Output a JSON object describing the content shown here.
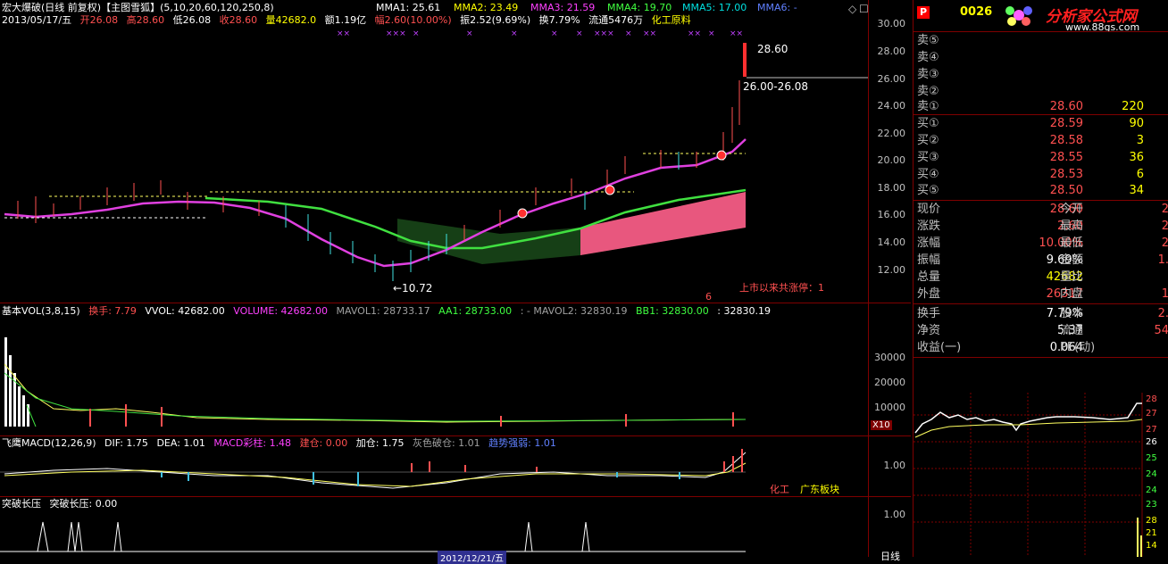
{
  "stock_header": {
    "title": "宏大爆破(日线 前复权)【主图雪狐】",
    "params": "(5,10,20,60,120,250,8)",
    "mma1": "MMA1: 25.61",
    "mma2": "MMA2: 23.49",
    "mma3": "MMA3: 21.59",
    "mma4": "MMA4: 19.70",
    "mma5": "MMA5: 17.00",
    "mma6": "MMA6: -"
  },
  "quote_line": {
    "date": "2013/05/17/五",
    "open": "开26.08",
    "high": "高28.60",
    "low": "低26.08",
    "close": "收28.60",
    "volume": "量42682.0",
    "amount": "额1.19亿",
    "change": "幅2.60(10.00%)",
    "amplitude": "振2.52(9.69%)",
    "turnover": "换7.79%",
    "float": "流通5476万",
    "industry": "化工原料"
  },
  "main_chart": {
    "annotations": {
      "high_price": "28.60",
      "range": "26.00-26.08",
      "low_price": "←10.72",
      "limit_up_text": "上市以来共涨停：1",
      "marker_six": "6"
    },
    "y_ticks": [
      "30.00",
      "28.00",
      "26.00",
      "24.00",
      "22.00",
      "20.00",
      "18.00",
      "16.00",
      "14.00",
      "12.00"
    ]
  },
  "vol_panel": {
    "title": "基本VOL(3,8,15)",
    "turnover": "换手: 7.79",
    "vvol": "VVOL: 42682.00",
    "volume": "VOLUME: 42682.00",
    "mavol1": "MAVOL1: 28733.17",
    "aa1": "AA1: 28733.00",
    "mavol2": ": - MAVOL2: 32830.19",
    "bb1": "BB1: 32830.00",
    "last": ": 32830.19",
    "y_ticks": [
      "30000",
      "20000",
      "10000"
    ],
    "unit": "X10"
  },
  "macd_panel": {
    "title": "飞鹰MACD(12,26,9)",
    "dif": "DIF: 1.75",
    "dea": "DEA: 1.01",
    "macd": "MACD彩柱: 1.48",
    "build": "建仓: 0.00",
    "add": "加仓: 1.75",
    "gray_break": "灰色破仓: 1.01",
    "trend": "趋势强弱: 1.01",
    "y_ticks": [
      "1.00"
    ],
    "sector_a": "化工",
    "sector_b": "广东板块"
  },
  "break_panel": {
    "title": "突破长压",
    "value": "突破长压: 0.00",
    "y_ticks": [
      "1.00"
    ],
    "bottom_date": "2012/12/21/五",
    "bottom_right": "日线"
  },
  "order_book": {
    "code": "0026",
    "logo_text": "分析家公式网",
    "logo_url": "www.88gs.com",
    "asks": [
      {
        "label": "卖⑤",
        "price": "",
        "vol": ""
      },
      {
        "label": "卖④",
        "price": "",
        "vol": ""
      },
      {
        "label": "卖③",
        "price": "",
        "vol": ""
      },
      {
        "label": "卖②",
        "price": "",
        "vol": ""
      },
      {
        "label": "卖①",
        "price": "28.60",
        "vol": "220"
      }
    ],
    "bids": [
      {
        "label": "买①",
        "price": "28.59",
        "vol": "90"
      },
      {
        "label": "买②",
        "price": "28.58",
        "vol": "3"
      },
      {
        "label": "买③",
        "price": "28.55",
        "vol": "36"
      },
      {
        "label": "买④",
        "price": "28.53",
        "vol": "6"
      },
      {
        "label": "买⑤",
        "price": "28.50",
        "vol": "34"
      }
    ],
    "stats": [
      {
        "label": "现价",
        "value": "28.60",
        "label2": "今开",
        "value2": "2"
      },
      {
        "label": "涨跌",
        "value": "2.60",
        "label2": "最高",
        "value2": "2"
      },
      {
        "label": "涨幅",
        "value": "10.00%",
        "label2": "最低",
        "value2": "2"
      },
      {
        "label": "振幅",
        "value": "9.69%",
        "label2": "金额",
        "value2": "1."
      },
      {
        "label": "总量",
        "value": "42682",
        "label2": "量比",
        "value2": ""
      },
      {
        "label": "外盘",
        "value": "26317",
        "label2": "内盘",
        "value2": "1"
      }
    ],
    "stats2": [
      {
        "label": "换手",
        "value": "7.79%",
        "label2": "股本",
        "value2": "2."
      },
      {
        "label": "净资",
        "value": "5.37",
        "label2": "流通",
        "value2": "54"
      },
      {
        "label": "收益(一)",
        "value": "0.064",
        "label2": "PE(动)",
        "value2": ""
      }
    ],
    "mini_ticks": [
      "28",
      "27",
      "27",
      "26",
      "25",
      "24",
      "24",
      "23",
      "28",
      "21",
      "14"
    ]
  }
}
